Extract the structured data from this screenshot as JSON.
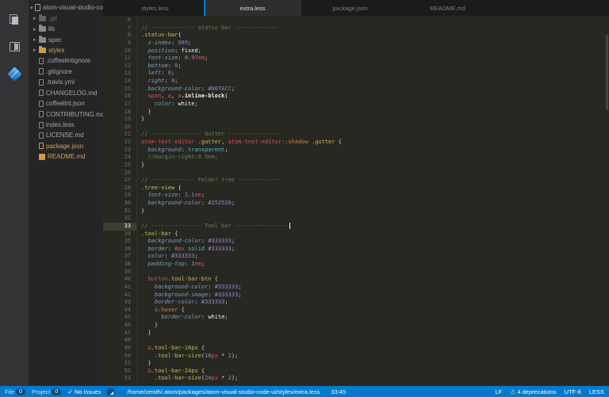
{
  "colors": {
    "accent": "#007ACC",
    "status_bar_bg": "#007ACC",
    "editor_bg": "#272822",
    "sidebar_bg": "#252526",
    "activity_bar_bg": "#333336",
    "modified_item": "#cfa05e",
    "warning_icon": "#f5d06c"
  },
  "activity_bar": {
    "icons": [
      "files-icon",
      "split-editor-icon",
      "packages-diamond-icon"
    ]
  },
  "sidebar": {
    "tree": [
      {
        "label": "atom-visual-studio-code-ui",
        "type": "root",
        "icon": "repo-icon",
        "expanded": true
      },
      {
        "label": ".git",
        "type": "folder",
        "icon": "folder-icon",
        "expanded": false,
        "dim": true
      },
      {
        "label": "lib",
        "type": "folder",
        "icon": "folder-icon",
        "expanded": false
      },
      {
        "label": "spec",
        "type": "folder",
        "icon": "folder-icon",
        "expanded": false
      },
      {
        "label": "styles",
        "type": "folder",
        "icon": "folder-icon",
        "expanded": false,
        "accent": true
      },
      {
        "label": ".coffeelintignore",
        "type": "file",
        "icon": "file-icon"
      },
      {
        "label": ".gitignore",
        "type": "file",
        "icon": "file-icon"
      },
      {
        "label": ".travis.yml",
        "type": "file",
        "icon": "file-icon"
      },
      {
        "label": "CHANGELOG.md",
        "type": "file",
        "icon": "file-icon"
      },
      {
        "label": "coffeelint.json",
        "type": "file",
        "icon": "file-icon"
      },
      {
        "label": "CONTRIBUTING.md",
        "type": "file",
        "icon": "file-icon"
      },
      {
        "label": "index.less",
        "type": "file",
        "icon": "file-icon"
      },
      {
        "label": "LICENSE.md",
        "type": "file",
        "icon": "file-icon"
      },
      {
        "label": "package.json",
        "type": "file",
        "icon": "package-icon",
        "accent": true
      },
      {
        "label": "README.md",
        "type": "file",
        "icon": "book-icon",
        "accent": true
      }
    ]
  },
  "editor": {
    "tabs": [
      {
        "label": "styles.less",
        "active": false
      },
      {
        "label": "extra.less",
        "active": true
      },
      {
        "label": "package.json",
        "active": false
      },
      {
        "label": "README.md",
        "active": false
      }
    ],
    "lines": [
      {
        "n": 6,
        "t": []
      },
      {
        "n": 7,
        "t": [
          [
            "c",
            "// ------------- status bar -------------"
          ]
        ]
      },
      {
        "n": 8,
        "t": [
          [
            "s",
            ".status-bar"
          ],
          [
            "x",
            "{"
          ]
        ]
      },
      {
        "n": 9,
        "t": [
          [
            "x",
            "  "
          ],
          [
            "p",
            "z-index"
          ],
          [
            "x",
            ": "
          ],
          [
            "n",
            "999"
          ],
          [
            "x",
            ";"
          ]
        ]
      },
      {
        "n": 10,
        "t": [
          [
            "x",
            "  "
          ],
          [
            "p",
            "position"
          ],
          [
            "x",
            ": "
          ],
          [
            "w",
            "fixed"
          ],
          [
            "x",
            ";"
          ]
        ]
      },
      {
        "n": 11,
        "t": [
          [
            "x",
            "  "
          ],
          [
            "p",
            "font-size"
          ],
          [
            "x",
            ": "
          ],
          [
            "n",
            "0.97"
          ],
          [
            "u",
            "em"
          ],
          [
            "x",
            ";"
          ]
        ]
      },
      {
        "n": 12,
        "t": [
          [
            "x",
            "  "
          ],
          [
            "p",
            "bottom"
          ],
          [
            "x",
            ": "
          ],
          [
            "n",
            "0"
          ],
          [
            "x",
            ";"
          ]
        ]
      },
      {
        "n": 13,
        "t": [
          [
            "x",
            "  "
          ],
          [
            "p",
            "left"
          ],
          [
            "x",
            ": "
          ],
          [
            "n",
            "0"
          ],
          [
            "x",
            ";"
          ]
        ]
      },
      {
        "n": 14,
        "t": [
          [
            "x",
            "  "
          ],
          [
            "p",
            "right"
          ],
          [
            "x",
            ": "
          ],
          [
            "n",
            "0"
          ],
          [
            "x",
            ";"
          ]
        ]
      },
      {
        "n": 15,
        "t": [
          [
            "x",
            "  "
          ],
          [
            "p",
            "background-color"
          ],
          [
            "x",
            ": "
          ],
          [
            "n",
            "#007ACC"
          ],
          [
            "x",
            ";"
          ]
        ]
      },
      {
        "n": 16,
        "t": [
          [
            "x",
            "  "
          ],
          [
            "t",
            "span"
          ],
          [
            "x",
            ", "
          ],
          [
            "t",
            "a"
          ],
          [
            "x",
            ", "
          ],
          [
            "t",
            "a"
          ],
          [
            "b",
            ".inline-block"
          ],
          [
            "x",
            "{"
          ]
        ]
      },
      {
        "n": 17,
        "t": [
          [
            "x",
            "    "
          ],
          [
            "p",
            "color"
          ],
          [
            "x",
            ": "
          ],
          [
            "w",
            "white"
          ],
          [
            "x",
            ";"
          ]
        ]
      },
      {
        "n": 18,
        "t": [
          [
            "x",
            "  }"
          ]
        ]
      },
      {
        "n": 19,
        "t": [
          [
            "x",
            "}"
          ]
        ]
      },
      {
        "n": 20,
        "t": []
      },
      {
        "n": 21,
        "t": [
          [
            "c",
            "// --------------- Gutter ---------------"
          ]
        ]
      },
      {
        "n": 22,
        "t": [
          [
            "t",
            "atom-text-editor"
          ],
          [
            "x",
            " "
          ],
          [
            "s",
            ".gutter"
          ],
          [
            "x",
            ", "
          ],
          [
            "t",
            "atom-text-editor"
          ],
          [
            "o",
            "::shadow"
          ],
          [
            "x",
            " "
          ],
          [
            "s",
            ".gutter"
          ],
          [
            "x",
            " {"
          ]
        ]
      },
      {
        "n": 23,
        "t": [
          [
            "x",
            "  "
          ],
          [
            "p",
            "background"
          ],
          [
            "x",
            ": "
          ],
          [
            "k",
            "transparent"
          ],
          [
            "x",
            ";"
          ]
        ]
      },
      {
        "n": 24,
        "t": [
          [
            "c",
            "  //margin-right:0.5em;"
          ]
        ]
      },
      {
        "n": 25,
        "t": [
          [
            "x",
            "}"
          ]
        ]
      },
      {
        "n": 26,
        "t": []
      },
      {
        "n": 27,
        "t": [
          [
            "c",
            "// ------------- Folder tree -------------"
          ]
        ]
      },
      {
        "n": 28,
        "t": [
          [
            "s",
            ".tree-view"
          ],
          [
            "x",
            " {"
          ]
        ]
      },
      {
        "n": 29,
        "t": [
          [
            "x",
            "  "
          ],
          [
            "p",
            "font-size"
          ],
          [
            "x",
            ": "
          ],
          [
            "n",
            "1.1"
          ],
          [
            "u",
            "em"
          ],
          [
            "x",
            ";"
          ]
        ]
      },
      {
        "n": 30,
        "t": [
          [
            "x",
            "  "
          ],
          [
            "p",
            "background-color"
          ],
          [
            "x",
            ": "
          ],
          [
            "n",
            "#252526"
          ],
          [
            "x",
            ";"
          ]
        ]
      },
      {
        "n": 31,
        "t": [
          [
            "x",
            "}"
          ]
        ]
      },
      {
        "n": 32,
        "t": []
      },
      {
        "n": 33,
        "cur": true,
        "t": [
          [
            "c",
            "// --------------- Tool bar ----------------"
          ]
        ]
      },
      {
        "n": 34,
        "t": [
          [
            "s",
            ".tool-bar"
          ],
          [
            "x",
            " {"
          ]
        ]
      },
      {
        "n": 35,
        "t": [
          [
            "x",
            "  "
          ],
          [
            "p",
            "background-color"
          ],
          [
            "x",
            ": "
          ],
          [
            "n",
            "#333333"
          ],
          [
            "x",
            ";"
          ]
        ]
      },
      {
        "n": 36,
        "t": [
          [
            "x",
            "  "
          ],
          [
            "p",
            "border"
          ],
          [
            "x",
            ": "
          ],
          [
            "n",
            "0"
          ],
          [
            "u",
            "px"
          ],
          [
            "x",
            " "
          ],
          [
            "k",
            "solid"
          ],
          [
            "x",
            " "
          ],
          [
            "n",
            "#333333"
          ],
          [
            "x",
            ";"
          ]
        ]
      },
      {
        "n": 37,
        "t": [
          [
            "x",
            "  "
          ],
          [
            "p",
            "color"
          ],
          [
            "x",
            ": "
          ],
          [
            "n",
            "#333333"
          ],
          [
            "x",
            ";"
          ]
        ]
      },
      {
        "n": 38,
        "t": [
          [
            "x",
            "  "
          ],
          [
            "p",
            "padding-top"
          ],
          [
            "x",
            ": "
          ],
          [
            "n",
            "1"
          ],
          [
            "u",
            "em"
          ],
          [
            "x",
            ";"
          ]
        ]
      },
      {
        "n": 39,
        "t": []
      },
      {
        "n": 40,
        "t": [
          [
            "x",
            "  "
          ],
          [
            "t",
            "button"
          ],
          [
            "s",
            ".tool-bar-btn"
          ],
          [
            "x",
            " {"
          ]
        ]
      },
      {
        "n": 41,
        "t": [
          [
            "x",
            "    "
          ],
          [
            "p",
            "background-color"
          ],
          [
            "x",
            ": "
          ],
          [
            "n",
            "#333333"
          ],
          [
            "x",
            ";"
          ]
        ]
      },
      {
        "n": 42,
        "t": [
          [
            "x",
            "    "
          ],
          [
            "p",
            "background-image"
          ],
          [
            "x",
            ": "
          ],
          [
            "n",
            "#333333"
          ],
          [
            "x",
            ";"
          ]
        ]
      },
      {
        "n": 43,
        "t": [
          [
            "x",
            "    "
          ],
          [
            "p",
            "border-color"
          ],
          [
            "x",
            ": "
          ],
          [
            "n",
            "#333333"
          ],
          [
            "x",
            ";"
          ]
        ]
      },
      {
        "n": 44,
        "t": [
          [
            "x",
            "    "
          ],
          [
            "t",
            "&"
          ],
          [
            "o",
            ":hover"
          ],
          [
            "x",
            " {"
          ]
        ]
      },
      {
        "n": 45,
        "t": [
          [
            "x",
            "      "
          ],
          [
            "p",
            "border-color"
          ],
          [
            "x",
            ": "
          ],
          [
            "w",
            "white"
          ],
          [
            "x",
            ";"
          ]
        ]
      },
      {
        "n": 46,
        "t": [
          [
            "x",
            "    }"
          ]
        ]
      },
      {
        "n": 47,
        "t": [
          [
            "x",
            "  }"
          ]
        ]
      },
      {
        "n": 48,
        "t": []
      },
      {
        "n": 49,
        "t": [
          [
            "x",
            "  "
          ],
          [
            "t",
            "&"
          ],
          [
            "s",
            ".tool-bar-16px"
          ],
          [
            "x",
            " {"
          ]
        ]
      },
      {
        "n": 50,
        "t": [
          [
            "x",
            "    "
          ],
          [
            "s",
            ".tool-bar-size"
          ],
          [
            "x",
            "("
          ],
          [
            "n",
            "16"
          ],
          [
            "u",
            "px"
          ],
          [
            "x",
            " * "
          ],
          [
            "n",
            "2"
          ],
          [
            "x",
            ");"
          ]
        ]
      },
      {
        "n": 51,
        "t": [
          [
            "x",
            "  }"
          ]
        ]
      },
      {
        "n": 52,
        "t": [
          [
            "x",
            "  "
          ],
          [
            "t",
            "&"
          ],
          [
            "s",
            ".tool-bar-24px"
          ],
          [
            "x",
            " {"
          ]
        ]
      },
      {
        "n": 53,
        "t": [
          [
            "x",
            "    "
          ],
          [
            "s",
            ".tool-bar-size"
          ],
          [
            "x",
            "("
          ],
          [
            "n",
            "24"
          ],
          [
            "u",
            "px"
          ],
          [
            "x",
            " * "
          ],
          [
            "n",
            "2"
          ],
          [
            "x",
            ");"
          ]
        ]
      }
    ]
  },
  "status_bar": {
    "file_counter_label": "File",
    "file_counter_value": "0",
    "project_counter_label": "Project",
    "project_counter_value": "0",
    "check_icon": "✓",
    "no_issues_label": "No Issues",
    "path": "/home/zeisth/.atom/packages/atom-visual-studio-code-ui/styles/extra.less",
    "cursor_position": "33:45",
    "line_ending": "LF",
    "warning_icon": "⚠",
    "deprecations_label": "4 deprecations",
    "encoding": "UTF-8",
    "grammar": "LESS"
  }
}
